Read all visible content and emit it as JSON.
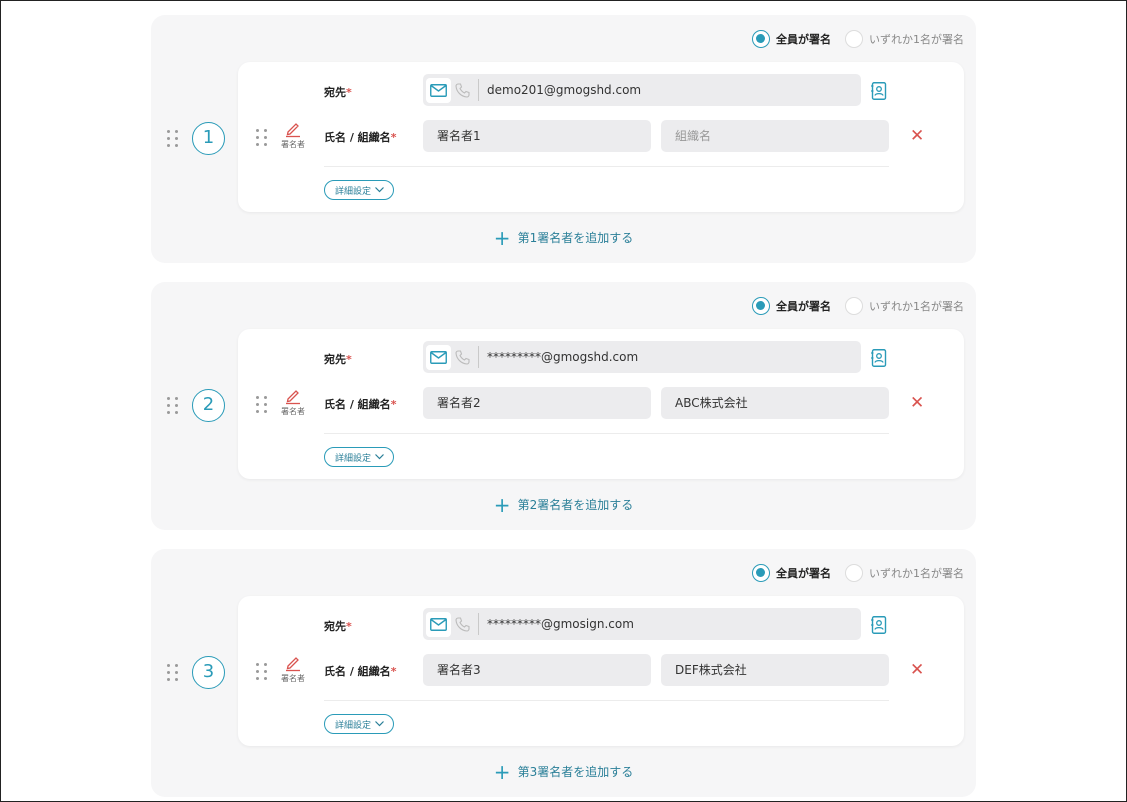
{
  "accent_color": "#2a9bb8",
  "delete_color": "#d9534f",
  "mode_options": {
    "all": "全員が署名",
    "any": "いずれか1名が署名",
    "selected": "all"
  },
  "labels": {
    "destination": "宛先",
    "name_org": "氏名 / 組織名",
    "required": "*",
    "role": "署名者",
    "detail": "詳細設定",
    "org_placeholder": "組織名"
  },
  "icons": {
    "drag": "drag-handle-icon",
    "pen": "pen-icon",
    "mail": "mail-icon",
    "phone": "phone-icon",
    "address_book": "address-book-icon",
    "delete": "close-icon",
    "chevron": "chevron-down-icon",
    "plus": "plus-icon"
  },
  "groups": [
    {
      "number": "1",
      "email": "demo201@gmogshd.com",
      "name": "署名者1",
      "org": "",
      "add_label": "第1署名者を追加する"
    },
    {
      "number": "2",
      "email": "*********@gmogshd.com",
      "name": "署名者2",
      "org": "ABC株式会社",
      "add_label": "第2署名者を追加する"
    },
    {
      "number": "3",
      "email": "*********@gmosign.com",
      "name": "署名者3",
      "org": "DEF株式会社",
      "add_label": "第3署名者を追加する"
    }
  ]
}
